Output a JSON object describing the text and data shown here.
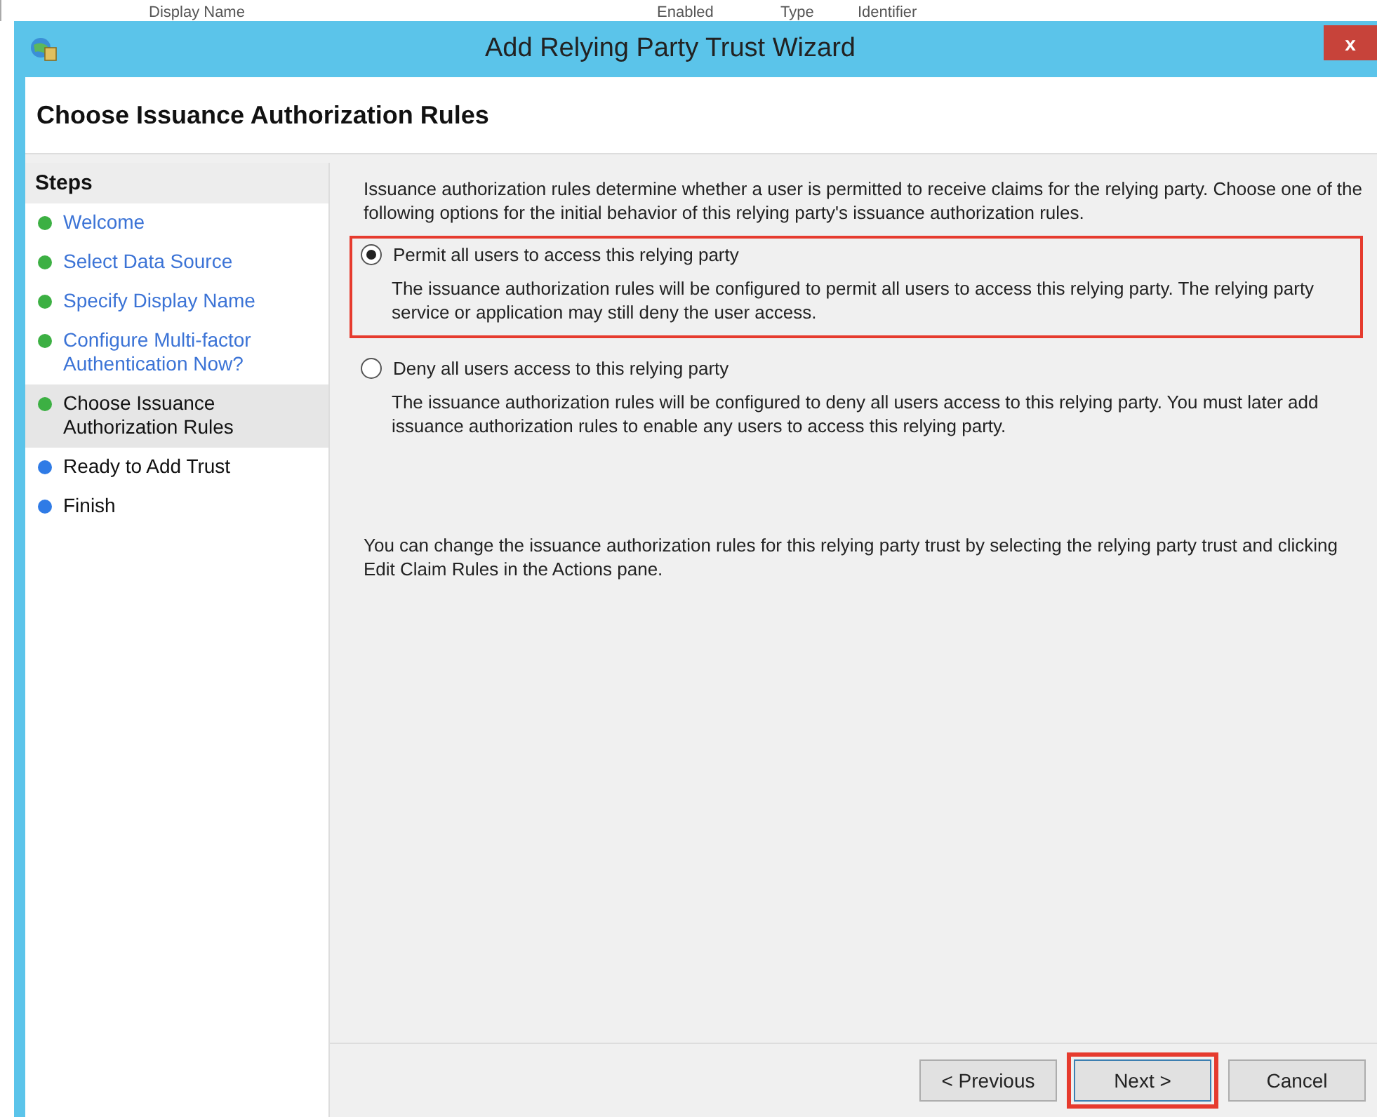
{
  "background_table": {
    "columns": [
      "Display Name",
      "Enabled",
      "Type",
      "Identifier"
    ]
  },
  "window": {
    "title": "Add Relying Party Trust Wizard",
    "close_label": "x"
  },
  "page_title": "Choose Issuance Authorization Rules",
  "steps": {
    "heading": "Steps",
    "items": [
      {
        "label": "Welcome",
        "color": "#3cb043",
        "link": true,
        "selected": false
      },
      {
        "label": "Select Data Source",
        "color": "#3cb043",
        "link": true,
        "selected": false
      },
      {
        "label": "Specify Display Name",
        "color": "#3cb043",
        "link": true,
        "selected": false
      },
      {
        "label": "Configure Multi-factor Authentication Now?",
        "color": "#3cb043",
        "link": true,
        "selected": false
      },
      {
        "label": "Choose Issuance Authorization Rules",
        "color": "#3cb043",
        "link": false,
        "selected": true
      },
      {
        "label": "Ready to Add Trust",
        "color": "#2f7be6",
        "link": false,
        "selected": false
      },
      {
        "label": "Finish",
        "color": "#2f7be6",
        "link": false,
        "selected": false
      }
    ]
  },
  "intro": "Issuance authorization rules determine whether a user is permitted to receive claims for the relying party. Choose one of the following options for the initial behavior of this relying party's issuance authorization rules.",
  "options": [
    {
      "label": "Permit all users to access this relying party",
      "description": "The issuance authorization rules will be configured to permit all users to access this relying party. The relying party service or application may still deny the user access.",
      "selected": true,
      "highlighted": true
    },
    {
      "label": "Deny all users access to this relying party",
      "description": "The issuance authorization rules will be configured to deny all users access to this relying party. You must later add issuance authorization rules to enable any users to access this relying party.",
      "selected": false,
      "highlighted": false
    }
  ],
  "note": "You can change the issuance authorization rules for this relying party trust by selecting the relying party trust and clicking Edit Claim Rules in the Actions pane.",
  "buttons": [
    {
      "label": "< Previous",
      "highlighted": false
    },
    {
      "label": "Next >",
      "highlighted": true
    },
    {
      "label": "Cancel",
      "highlighted": false
    }
  ]
}
